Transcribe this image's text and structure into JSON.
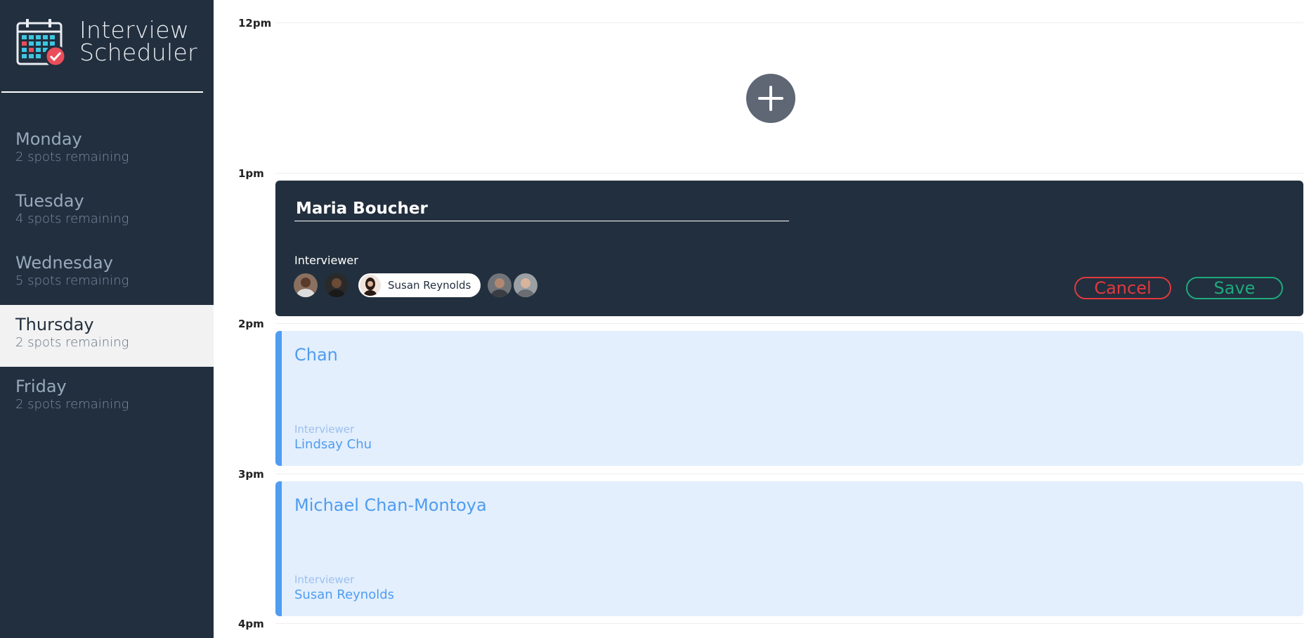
{
  "app": {
    "title_line1": "Interview",
    "title_line2": "Scheduler"
  },
  "days": [
    {
      "name": "Monday",
      "spots": "2 spots remaining",
      "selected": false
    },
    {
      "name": "Tuesday",
      "spots": "4 spots remaining",
      "selected": false
    },
    {
      "name": "Wednesday",
      "spots": "5 spots remaining",
      "selected": false
    },
    {
      "name": "Thursday",
      "spots": "2 spots remaining",
      "selected": true
    },
    {
      "name": "Friday",
      "spots": "2 spots remaining",
      "selected": false
    }
  ],
  "times": [
    "12pm",
    "1pm",
    "2pm",
    "3pm",
    "4pm"
  ],
  "form": {
    "student_value": "Maria Boucher",
    "interviewer_label": "Interviewer",
    "selected_interviewer": "Susan Reynolds",
    "cancel_label": "Cancel",
    "save_label": "Save"
  },
  "appointments": [
    {
      "student": "Chan",
      "interviewer_label": "Interviewer",
      "interviewer": "Lindsay Chu"
    },
    {
      "student": "Michael Chan-Montoya",
      "interviewer_label": "Interviewer",
      "interviewer": "Susan Reynolds"
    }
  ],
  "colors": {
    "sidebar": "#222f3e",
    "appointment_bg": "#e3effd",
    "appointment_accent": "#4f9cf0",
    "cancel": "#e0393f",
    "save": "#1eaa7e"
  }
}
